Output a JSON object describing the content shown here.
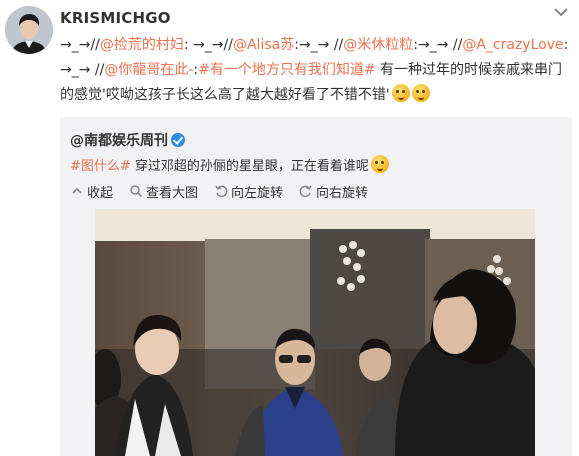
{
  "author": {
    "name": "KRISMICHGO"
  },
  "post": {
    "parts": [
      {
        "text": "→_→//",
        "link": false
      },
      {
        "text": "@捡荒的村妇",
        "link": true
      },
      {
        "text": ": →_→//",
        "link": false
      },
      {
        "text": "@Alisa苏",
        "link": true
      },
      {
        "text": ":→_→ //",
        "link": false
      },
      {
        "text": "@米休粒粒",
        "link": true
      },
      {
        "text": ":→_→ //",
        "link": false
      },
      {
        "text": "@A_crazyLove",
        "link": true
      },
      {
        "text": ":→_→ //",
        "link": false
      },
      {
        "text": "@你龍哥在此-",
        "link": true
      },
      {
        "text": ":",
        "link": false
      },
      {
        "text": "#有一个地方只有我们知道#",
        "link": true
      },
      {
        "text": " 有一种过年的时候亲戚来串门的感觉'哎呦这孩子长这么高了越大越好看了不错不错'",
        "link": false
      }
    ]
  },
  "repost": {
    "author": "@南都娱乐周刊",
    "hashtag": "#图什么#",
    "text": " 穿过邓超的孙俪的星星眼，正在看着谁呢"
  },
  "actions": [
    {
      "label": "收起",
      "icon": "collapse-icon"
    },
    {
      "label": "查看大图",
      "icon": "zoom-icon"
    },
    {
      "label": "向左旋转",
      "icon": "rotate-left-icon"
    },
    {
      "label": "向右旋转",
      "icon": "rotate-right-icon"
    }
  ],
  "colors": {
    "link": "#eb7350",
    "repost_bg": "#f2f2f5",
    "verified": "#2f89e6"
  }
}
